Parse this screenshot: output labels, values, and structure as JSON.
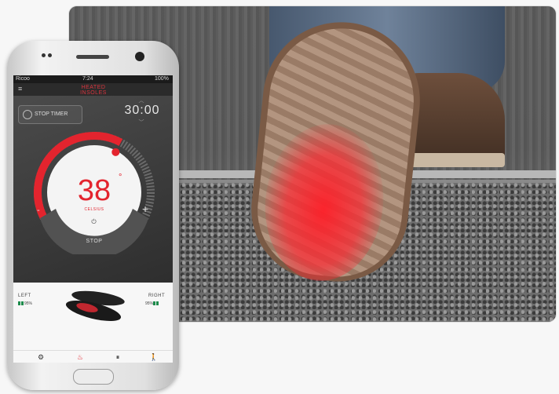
{
  "colors": {
    "accent": "#e3242e",
    "panel": "#3a3a3a",
    "battery": "#1e8b4c"
  },
  "status": {
    "carrier": "Ricoo",
    "time": "7:24",
    "battery": "100%"
  },
  "app": {
    "brand": "HEATED INSOLES",
    "menu_icon": "hamburger-icon"
  },
  "timer": {
    "button_label": "STOP TIMER",
    "value": "30:00"
  },
  "dial": {
    "value": "38",
    "unit_symbol": "°",
    "unit": "CELSIUS",
    "minus": "-",
    "plus": "+",
    "stop_label": "STOP",
    "level": 0.62
  },
  "insoles": {
    "left": {
      "label": "LEFT",
      "battery": "95%"
    },
    "right": {
      "label": "RIGHT",
      "battery": "95%"
    }
  },
  "navbar": {
    "items": [
      "settings-icon",
      "heat-icon",
      "insoles-icon",
      "walk-icon"
    ]
  }
}
